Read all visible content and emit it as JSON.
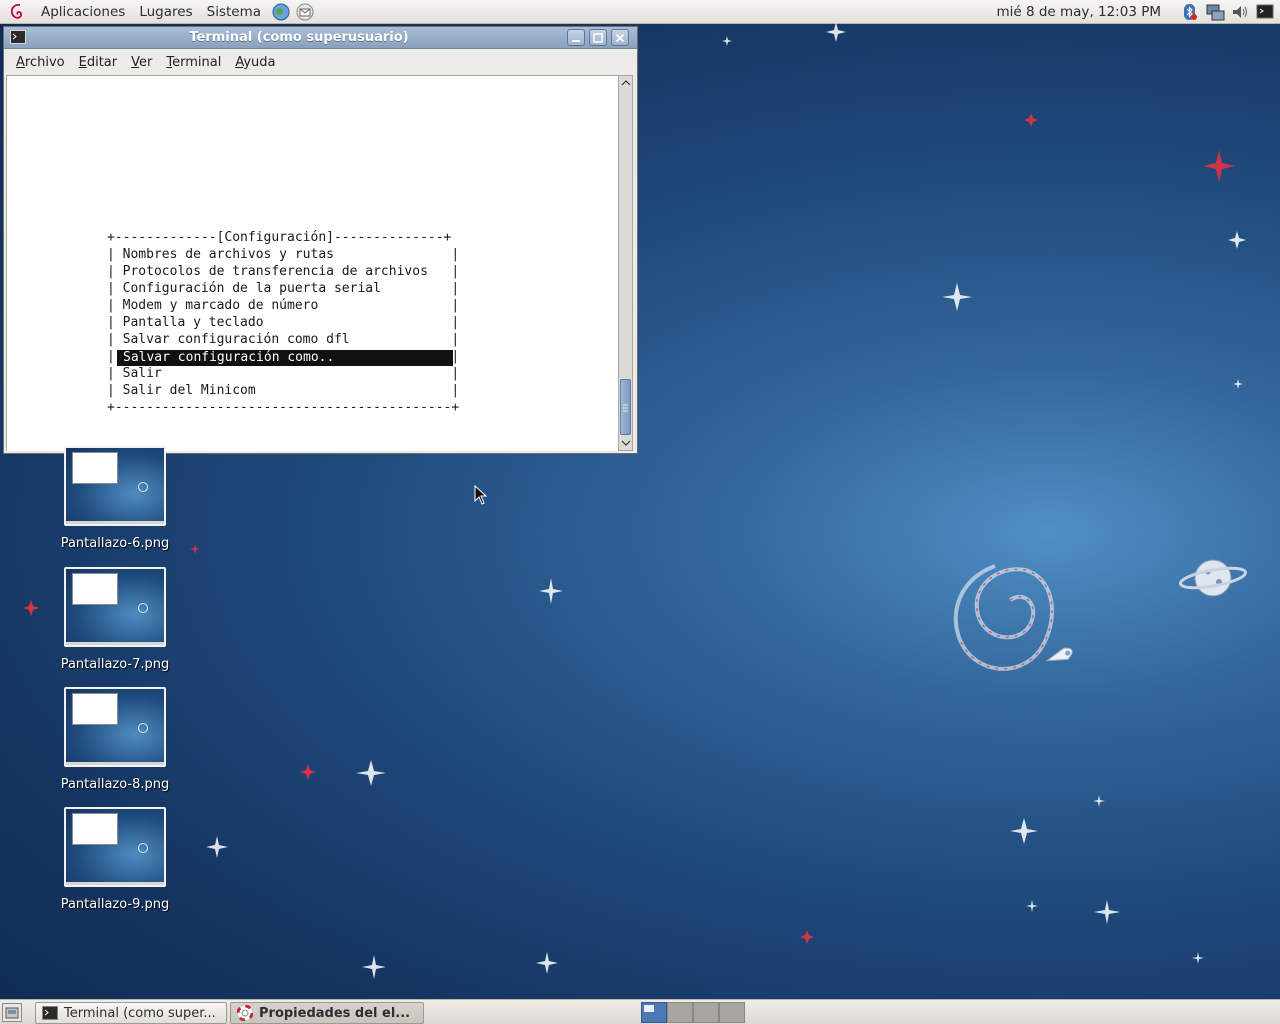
{
  "top_panel": {
    "menus": [
      "Aplicaciones",
      "Lugares",
      "Sistema"
    ],
    "clock": "mié  8 de may, 12:03 PM",
    "tray_icons": [
      "bluetooth-icon",
      "network-icon",
      "volume-icon",
      "terminal-icon"
    ]
  },
  "terminal_window": {
    "title": "Terminal (como superusuario)",
    "menu": [
      {
        "first": "A",
        "rest": "rchivo"
      },
      {
        "first": "E",
        "rest": "ditar"
      },
      {
        "first": "V",
        "rest": "er"
      },
      {
        "first": "T",
        "rest": "erminal"
      },
      {
        "first": "A",
        "rest": "yuda"
      }
    ],
    "screen": {
      "box_top": "+-------------[Configuración]--------------+",
      "lines": [
        "| Nombres de archivos y rutas               |",
        "| Protocolos de transferencia de archivos   |",
        "| Configuración de la puerta serial         |",
        "| Modem y marcado de número                 |",
        "| Pantalla y teclado                        |",
        "| Salvar configuración como dfl             |",
        "|                                           |",
        "| Salir                                     |",
        "| Salir del Minicom                         |"
      ],
      "selected_item": "Salvar configuración como..",
      "box_bottom": "+-------------------------------------------+"
    }
  },
  "desktop_icons": [
    {
      "label": "Pantallazo-6.png"
    },
    {
      "label": "Pantallazo-7.png"
    },
    {
      "label": "Pantallazo-8.png"
    },
    {
      "label": "Pantallazo-9.png"
    }
  ],
  "taskbar": {
    "tasks": [
      {
        "label": "Terminal (como super...",
        "active": false
      },
      {
        "label": "Propiedades del el...",
        "active": true
      }
    ],
    "workspaces": 4,
    "active_workspace": 1
  },
  "colors": {
    "desktop_bg": "#1f4a7c",
    "titlebar": "#8aa1be",
    "selection_bg": "#111111",
    "active_workspace": "#4b79b4"
  }
}
